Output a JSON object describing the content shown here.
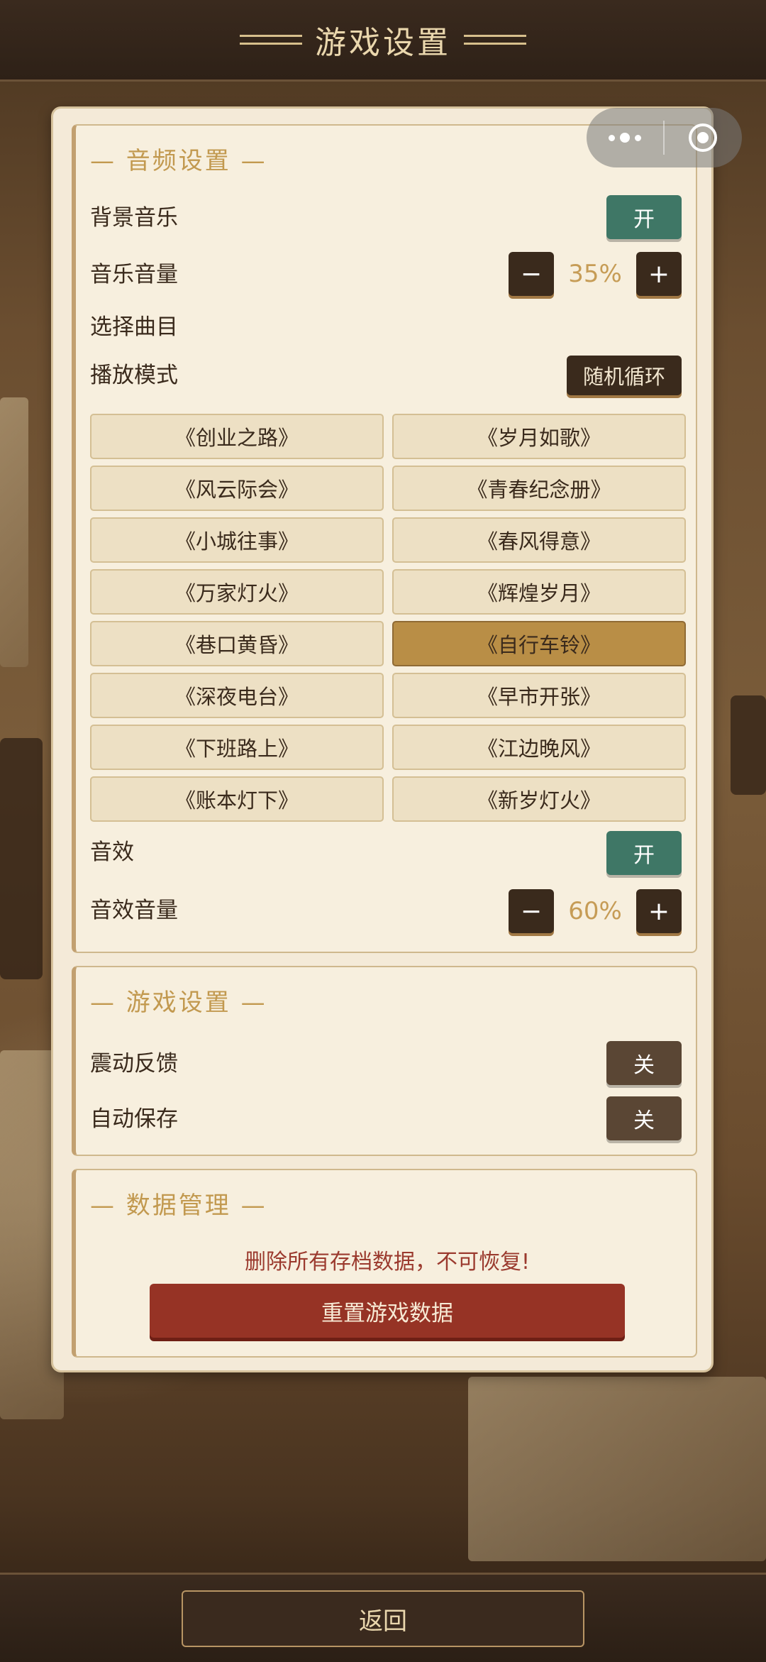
{
  "header": {
    "title": "游戏设置"
  },
  "audio": {
    "section_title": "— 音频设置 —",
    "bgm_label": "背景音乐",
    "bgm_toggle": "开",
    "music_volume_label": "音乐音量",
    "music_volume_value": "35%",
    "minus": "−",
    "plus": "+",
    "track_select_label": "选择曲目",
    "play_mode_label": "播放模式",
    "play_mode_value": "随机循环",
    "tracks": [
      {
        "name": "《创业之路》"
      },
      {
        "name": "《岁月如歌》"
      },
      {
        "name": "《风云际会》"
      },
      {
        "name": "《青春纪念册》"
      },
      {
        "name": "《小城往事》"
      },
      {
        "name": "《春风得意》"
      },
      {
        "name": "《万家灯火》"
      },
      {
        "name": "《辉煌岁月》"
      },
      {
        "name": "《巷口黄昏》"
      },
      {
        "name": "《自行车铃》",
        "selected": true
      },
      {
        "name": "《深夜电台》"
      },
      {
        "name": "《早市开张》"
      },
      {
        "name": "《下班路上》"
      },
      {
        "name": "《江边晚风》"
      },
      {
        "name": "《账本灯下》"
      },
      {
        "name": "《新岁灯火》"
      }
    ],
    "sfx_label": "音效",
    "sfx_toggle": "开",
    "sfx_volume_label": "音效音量",
    "sfx_volume_value": "60%"
  },
  "game": {
    "section_title": "— 游戏设置 —",
    "vibration_label": "震动反馈",
    "vibration_toggle": "关",
    "autosave_label": "自动保存",
    "autosave_toggle": "关"
  },
  "data_mgmt": {
    "section_title": "— 数据管理 —",
    "warning": "删除所有存档数据，不可恢复!",
    "reset_label": "重置游戏数据"
  },
  "footer": {
    "back_label": "返回"
  },
  "colors": {
    "toggle_on": "#3f7766",
    "toggle_off": "#5a4634",
    "accent_gold": "#c2994f",
    "danger": "#963325",
    "selected_track": "#b98e46"
  },
  "icons": {
    "capsule_menu": "more-dots-icon",
    "capsule_close": "target-circle-icon"
  }
}
